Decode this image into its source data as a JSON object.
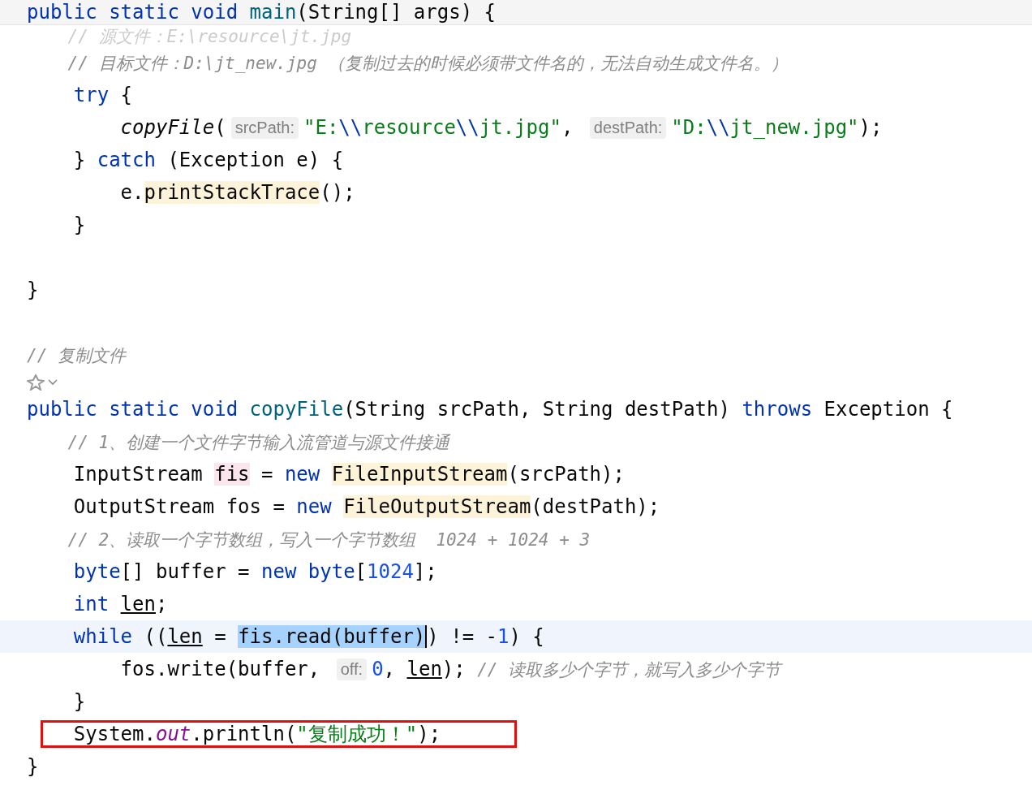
{
  "editor": {
    "sticky_header": {
      "tokens": [
        {
          "kind": "keyword",
          "text": "public static void "
        },
        {
          "kind": "method",
          "text": "main"
        },
        {
          "kind": "plain",
          "text": "(String[] args) {"
        }
      ]
    },
    "lines": [
      {
        "kind": "code",
        "faded": true,
        "current": false,
        "annotated": false,
        "tokens": [
          {
            "kind": "comment",
            "text": "    // 源文件：E:\\resource\\jt.jpg"
          }
        ]
      },
      {
        "kind": "code",
        "faded": false,
        "current": false,
        "annotated": false,
        "tokens": [
          {
            "kind": "comment",
            "text": "    // 目标文件：D:\\jt_new.jpg （复制过去的时候必须带文件名的，无法自动生成文件名。）"
          }
        ]
      },
      {
        "kind": "code",
        "faded": false,
        "current": false,
        "annotated": false,
        "tokens": [
          {
            "kind": "keyword",
            "text": "    try"
          },
          {
            "kind": "plain",
            "text": " {"
          }
        ]
      },
      {
        "kind": "code",
        "faded": false,
        "current": false,
        "annotated": false,
        "tokens": [
          {
            "kind": "call",
            "text": "        copyFile"
          },
          {
            "kind": "plain",
            "text": "("
          },
          {
            "kind": "hint",
            "text": "srcPath:"
          },
          {
            "kind": "string",
            "text": "\"E:"
          },
          {
            "kind": "escape",
            "text": "\\\\"
          },
          {
            "kind": "string",
            "text": "resource"
          },
          {
            "kind": "escape",
            "text": "\\\\"
          },
          {
            "kind": "string",
            "text": "jt.jpg\""
          },
          {
            "kind": "plain",
            "text": ", "
          },
          {
            "kind": "hint",
            "text": "destPath:"
          },
          {
            "kind": "string",
            "text": "\"D:"
          },
          {
            "kind": "escape",
            "text": "\\\\"
          },
          {
            "kind": "string",
            "text": "jt_new.jpg\""
          },
          {
            "kind": "plain",
            "text": ");"
          }
        ]
      },
      {
        "kind": "code",
        "faded": false,
        "current": false,
        "annotated": false,
        "tokens": [
          {
            "kind": "plain",
            "text": "    } "
          },
          {
            "kind": "keyword",
            "text": "catch"
          },
          {
            "kind": "plain",
            "text": " (Exception e) {"
          }
        ]
      },
      {
        "kind": "code",
        "faded": false,
        "current": false,
        "annotated": false,
        "tokens": [
          {
            "kind": "plain",
            "text": "        e."
          },
          {
            "kind": "usage",
            "text": "printStackTrace"
          },
          {
            "kind": "plain",
            "text": "();"
          }
        ]
      },
      {
        "kind": "code",
        "faded": false,
        "current": false,
        "annotated": false,
        "tokens": [
          {
            "kind": "plain",
            "text": "    }"
          }
        ]
      },
      {
        "kind": "blank"
      },
      {
        "kind": "code",
        "faded": false,
        "current": false,
        "annotated": false,
        "tokens": [
          {
            "kind": "plain",
            "text": "}"
          }
        ]
      },
      {
        "kind": "blank"
      },
      {
        "kind": "code",
        "faded": false,
        "current": false,
        "annotated": false,
        "tokens": [
          {
            "kind": "comment",
            "text": "// 复制文件"
          }
        ]
      },
      {
        "kind": "gutter-icon"
      },
      {
        "kind": "code",
        "faded": false,
        "current": false,
        "annotated": false,
        "tokens": [
          {
            "kind": "keyword",
            "text": "public static void "
          },
          {
            "kind": "method",
            "text": "copyFile"
          },
          {
            "kind": "plain",
            "text": "(String srcPath, String destPath) "
          },
          {
            "kind": "keyword",
            "text": "throws"
          },
          {
            "kind": "plain",
            "text": " Exception {"
          }
        ]
      },
      {
        "kind": "code",
        "faded": false,
        "current": false,
        "annotated": false,
        "tokens": [
          {
            "kind": "comment",
            "text": "    // 1、创建一个文件字节输入流管道与源文件接通"
          }
        ]
      },
      {
        "kind": "code",
        "faded": false,
        "current": false,
        "annotated": false,
        "tokens": [
          {
            "kind": "plain",
            "text": "    InputStream "
          },
          {
            "kind": "write",
            "text": "fis"
          },
          {
            "kind": "plain",
            "text": " = "
          },
          {
            "kind": "keyword",
            "text": "new "
          },
          {
            "kind": "usage",
            "text": "FileInputStream"
          },
          {
            "kind": "plain",
            "text": "(srcPath);"
          }
        ]
      },
      {
        "kind": "code",
        "faded": false,
        "current": false,
        "annotated": false,
        "tokens": [
          {
            "kind": "plain",
            "text": "    OutputStream fos = "
          },
          {
            "kind": "keyword",
            "text": "new "
          },
          {
            "kind": "usage",
            "text": "FileOutputStream"
          },
          {
            "kind": "plain",
            "text": "(destPath);"
          }
        ]
      },
      {
        "kind": "code",
        "faded": false,
        "current": false,
        "annotated": false,
        "tokens": [
          {
            "kind": "comment",
            "text": "    // 2、读取一个字节数组，写入一个字节数组  1024 + 1024 + 3"
          }
        ]
      },
      {
        "kind": "code",
        "faded": false,
        "current": false,
        "annotated": false,
        "tokens": [
          {
            "kind": "keyword",
            "text": "    byte"
          },
          {
            "kind": "plain",
            "text": "[] buffer = "
          },
          {
            "kind": "keyword",
            "text": "new byte"
          },
          {
            "kind": "plain",
            "text": "["
          },
          {
            "kind": "number",
            "text": "1024"
          },
          {
            "kind": "plain",
            "text": "];"
          }
        ]
      },
      {
        "kind": "code",
        "faded": false,
        "current": false,
        "annotated": false,
        "tokens": [
          {
            "kind": "keyword",
            "text": "    int "
          },
          {
            "kind": "underlined",
            "text": "len"
          },
          {
            "kind": "plain",
            "text": ";"
          }
        ]
      },
      {
        "kind": "code",
        "faded": false,
        "current": true,
        "annotated": false,
        "tokens": [
          {
            "kind": "keyword",
            "text": "    while"
          },
          {
            "kind": "plain",
            "text": " (("
          },
          {
            "kind": "underlined",
            "text": "len"
          },
          {
            "kind": "plain",
            "text": " = "
          },
          {
            "kind": "selection",
            "text": "fis.read(buffer)"
          },
          {
            "kind": "caret"
          },
          {
            "kind": "plain",
            "text": ") != -"
          },
          {
            "kind": "number",
            "text": "1"
          },
          {
            "kind": "plain",
            "text": ") {"
          }
        ]
      },
      {
        "kind": "code",
        "faded": false,
        "current": false,
        "annotated": false,
        "tokens": [
          {
            "kind": "plain",
            "text": "        fos.write(buffer, "
          },
          {
            "kind": "hint",
            "text": "off:"
          },
          {
            "kind": "number",
            "text": "0"
          },
          {
            "kind": "plain",
            "text": ", "
          },
          {
            "kind": "underlined",
            "text": "len"
          },
          {
            "kind": "plain",
            "text": "); "
          },
          {
            "kind": "comment",
            "text": "// 读取多少个字节，就写入多少个字节"
          }
        ]
      },
      {
        "kind": "code",
        "faded": false,
        "current": false,
        "annotated": false,
        "tokens": [
          {
            "kind": "plain",
            "text": "    }"
          }
        ]
      },
      {
        "kind": "code",
        "faded": false,
        "current": false,
        "annotated": true,
        "tokens": [
          {
            "kind": "plain",
            "text": "    System."
          },
          {
            "kind": "field",
            "text": "out"
          },
          {
            "kind": "plain",
            "text": ".println("
          },
          {
            "kind": "string",
            "text": "\"复制成功！\""
          },
          {
            "kind": "plain",
            "text": ");"
          }
        ]
      },
      {
        "kind": "code",
        "faded": false,
        "current": false,
        "annotated": false,
        "tokens": [
          {
            "kind": "plain",
            "text": "}"
          }
        ]
      }
    ]
  }
}
